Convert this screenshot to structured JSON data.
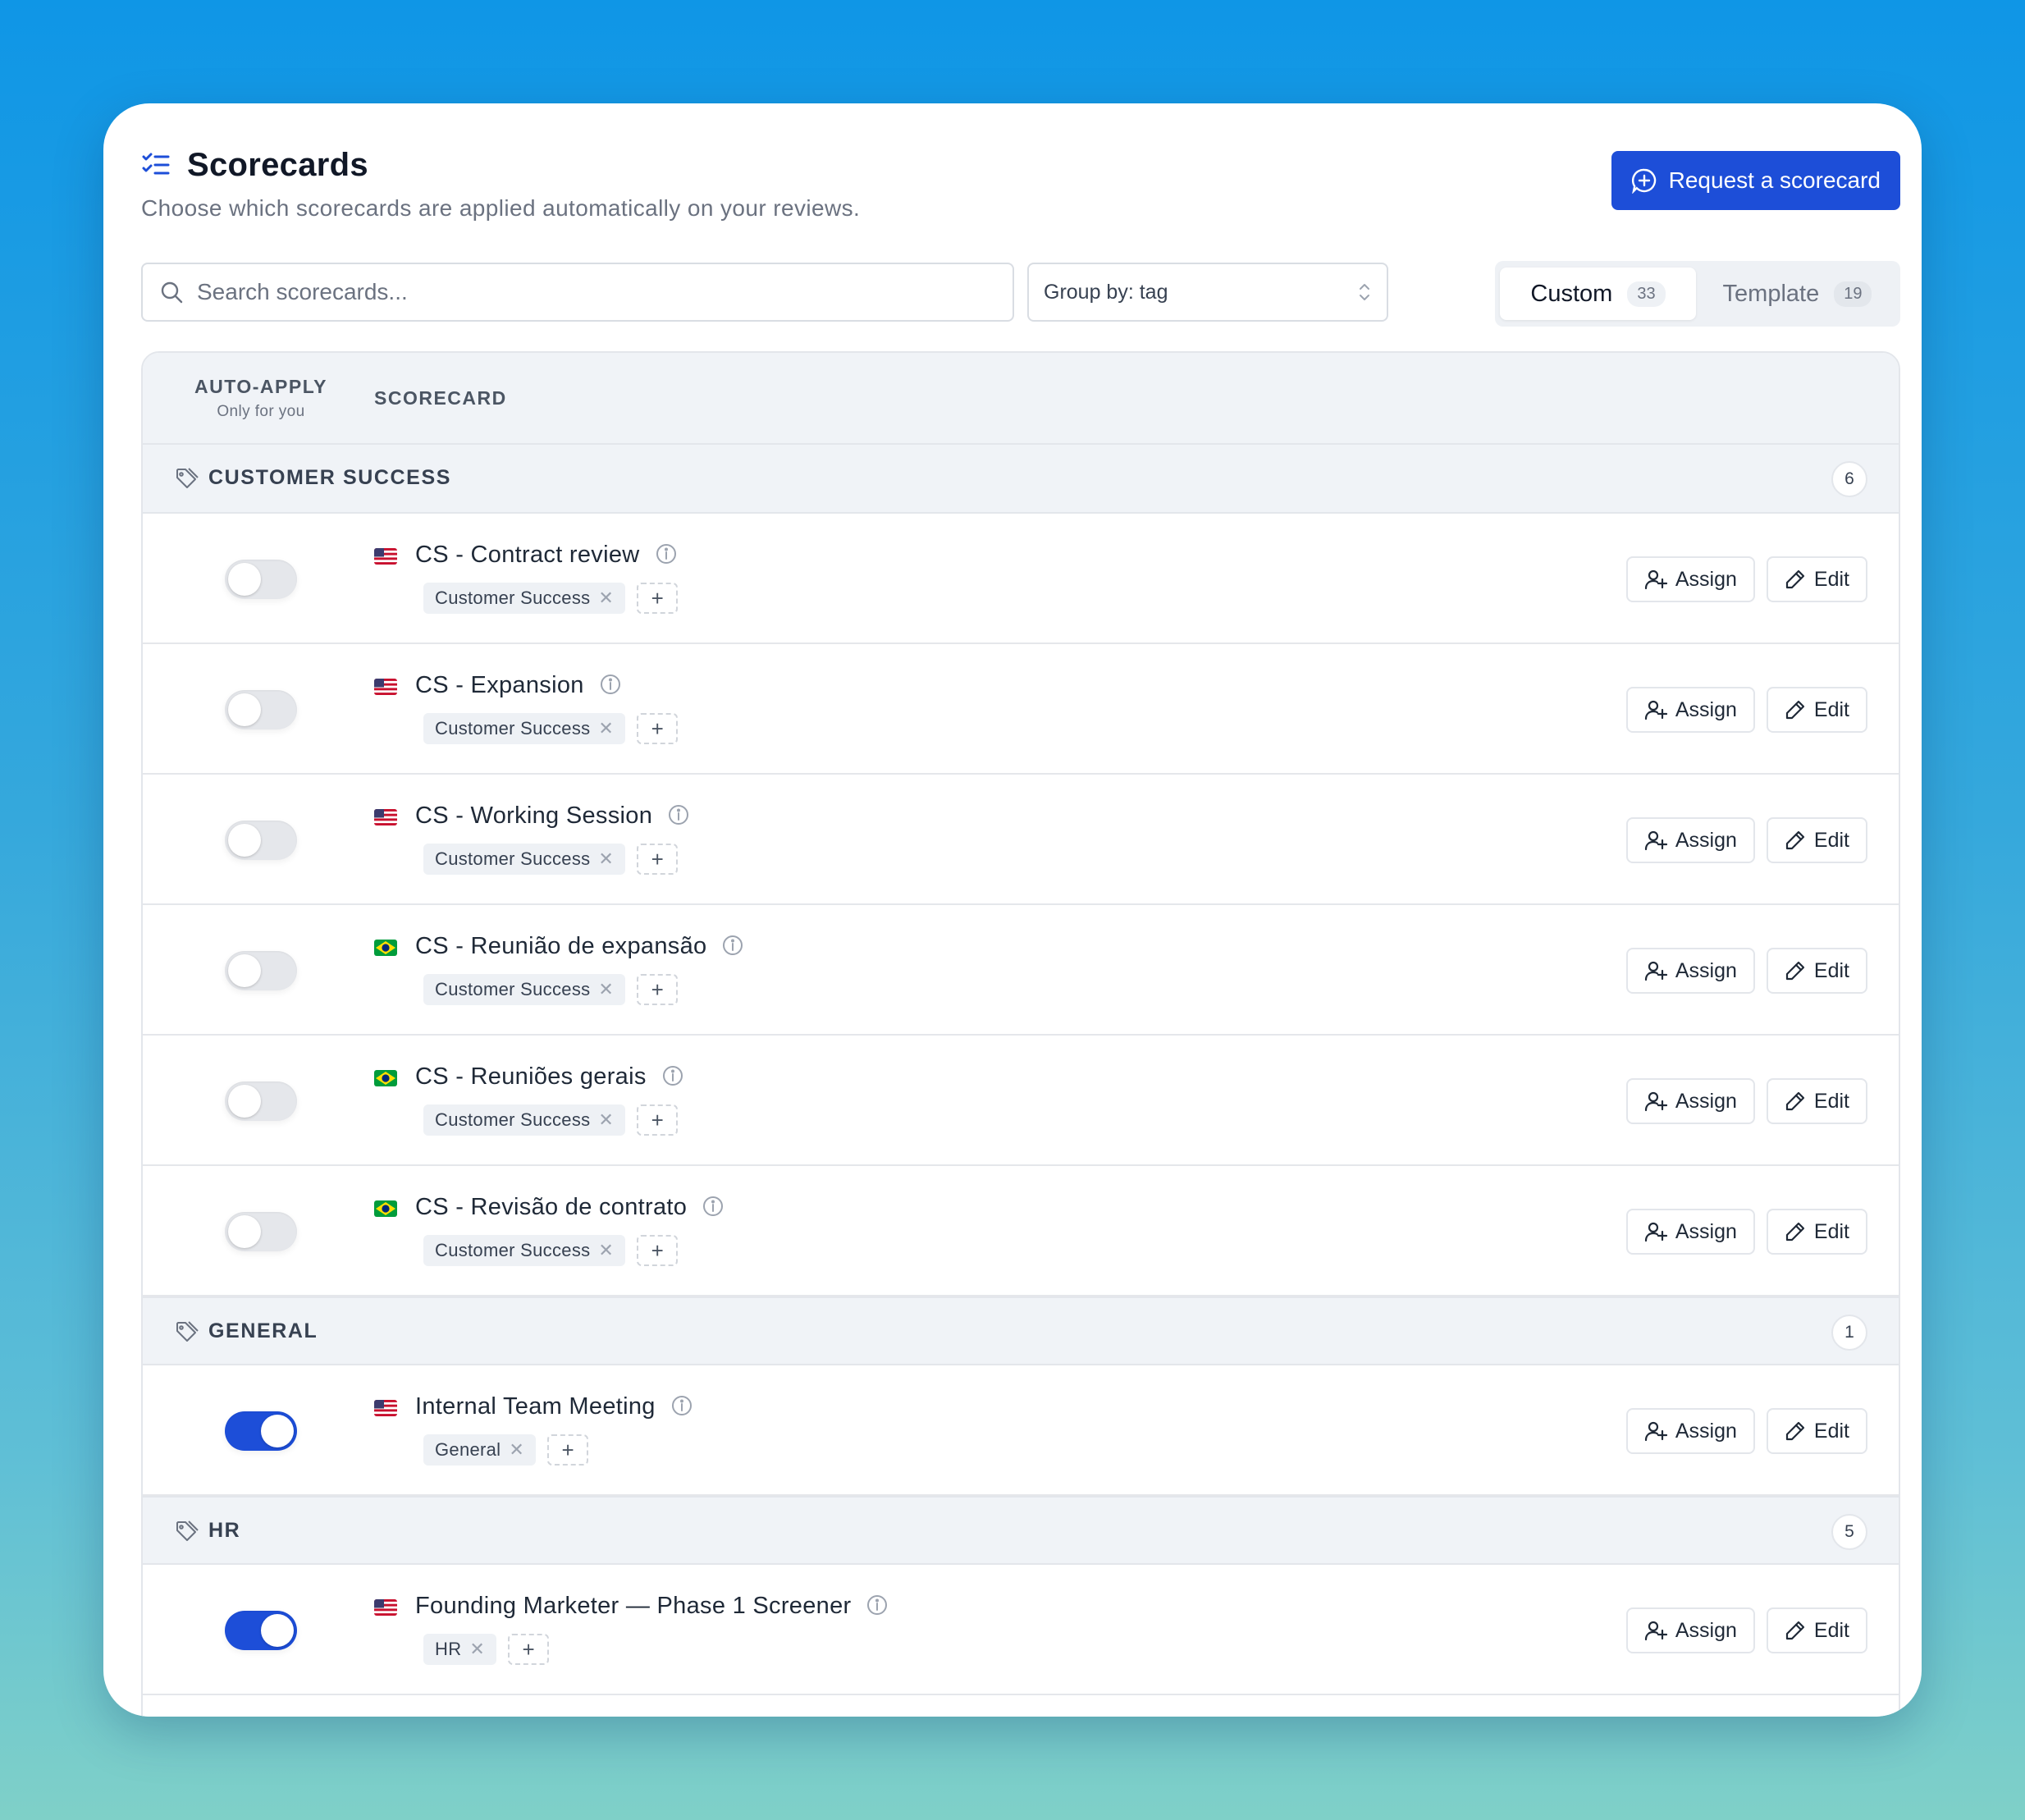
{
  "header": {
    "title": "Scorecards",
    "subtitle": "Choose which scorecards are applied automatically on your reviews.",
    "request_button": "Request a scorecard"
  },
  "toolbar": {
    "search_placeholder": "Search scorecards...",
    "group_by": "Group by: tag",
    "tabs": [
      {
        "label": "Custom",
        "count": "33",
        "active": true
      },
      {
        "label": "Template",
        "count": "19",
        "active": false
      }
    ]
  },
  "table": {
    "col_auto_apply": "AUTO-APPLY",
    "col_auto_apply_sub": "Only for you",
    "col_scorecard": "SCORECARD",
    "assign_label": "Assign",
    "edit_label": "Edit",
    "groups": [
      {
        "name": "CUSTOMER SUCCESS",
        "count": "6",
        "rows": [
          {
            "name": "CS - Contract review",
            "flag": "us",
            "tag": "Customer Success",
            "enabled": false
          },
          {
            "name": "CS - Expansion",
            "flag": "us",
            "tag": "Customer Success",
            "enabled": false
          },
          {
            "name": "CS - Working Session",
            "flag": "us",
            "tag": "Customer Success",
            "enabled": false
          },
          {
            "name": "CS - Reunião de expansão",
            "flag": "br",
            "tag": "Customer Success",
            "enabled": false
          },
          {
            "name": "CS - Reuniões gerais",
            "flag": "br",
            "tag": "Customer Success",
            "enabled": false
          },
          {
            "name": "CS - Revisão de contrato",
            "flag": "br",
            "tag": "Customer Success",
            "enabled": false
          }
        ]
      },
      {
        "name": "GENERAL",
        "count": "1",
        "rows": [
          {
            "name": "Internal Team Meeting",
            "flag": "us",
            "tag": "General",
            "enabled": true
          }
        ]
      },
      {
        "name": "HR",
        "count": "5",
        "rows": [
          {
            "name": "Founding Marketer — Phase 1 Screener",
            "flag": "us",
            "tag": "HR",
            "enabled": true
          }
        ]
      }
    ]
  },
  "colors": {
    "accent": "#1d4ed8",
    "header_bg": "#f0f3f7"
  }
}
